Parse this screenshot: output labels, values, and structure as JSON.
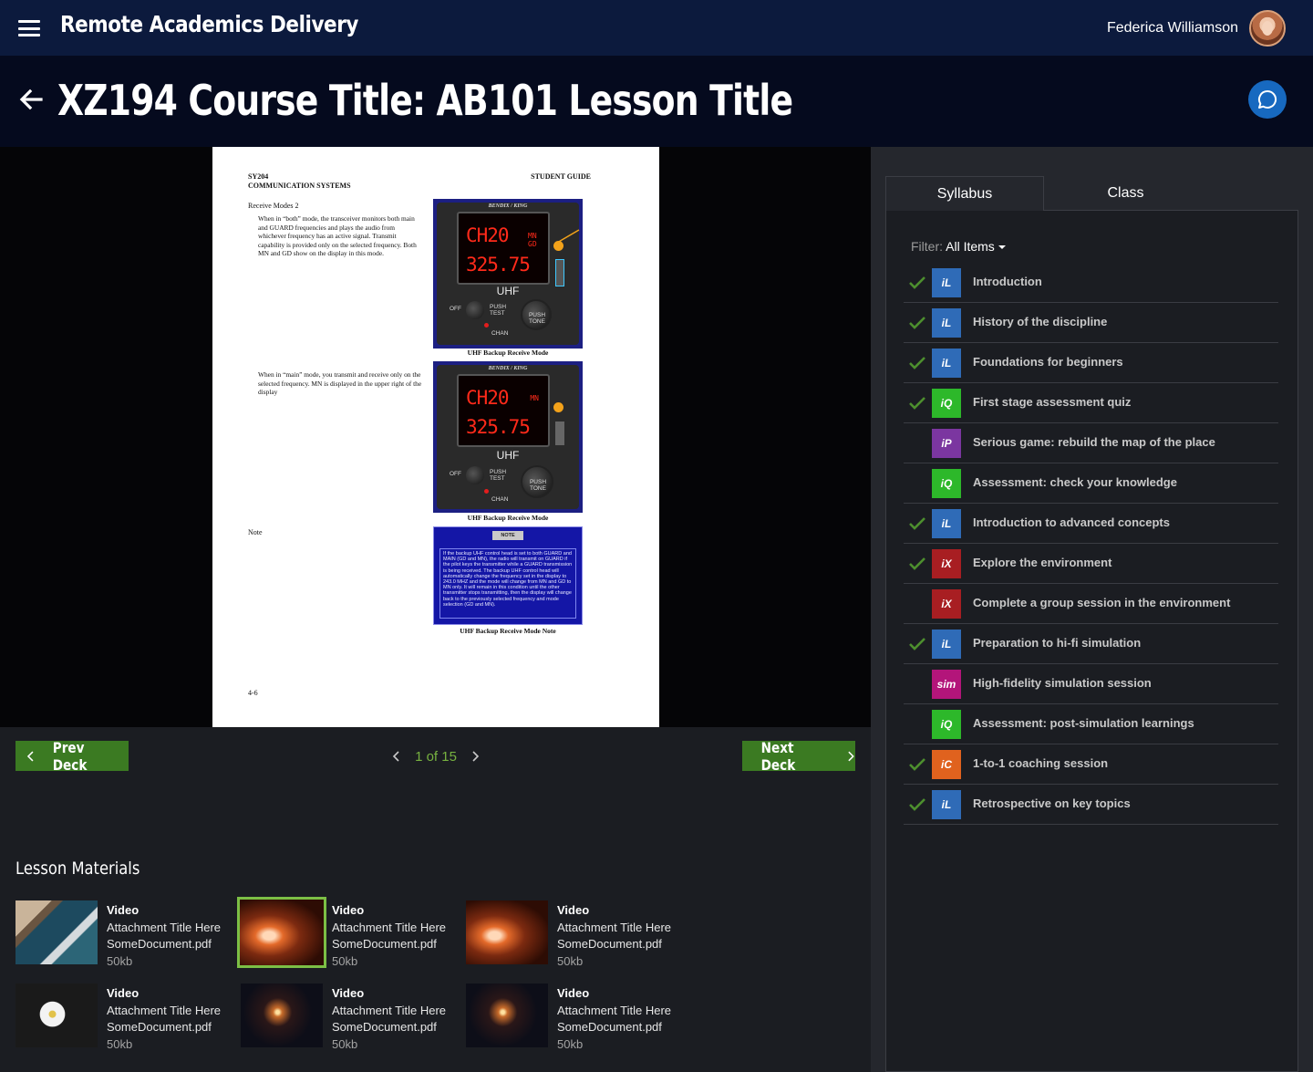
{
  "app": {
    "title": "Remote Academics Delivery",
    "user_name": "Federica Williamson"
  },
  "header": {
    "title": "XZ194 Course Title: AB101 Lesson Title"
  },
  "document": {
    "header_left_1": "SY204",
    "header_left_2": "COMMUNICATION SYSTEMS",
    "header_right": "STUDENT GUIDE",
    "subheading": "Receive Modes 2",
    "para1": "When in “both” mode, the transceiver monitors both main and GUARD frequencies and plays the audio from whichever frequency has an active signal. Transmit capability is provided only on the selected frequency. Both MN and GD show on the display in this mode.",
    "para2": "When in “main” mode, you transmit and receive only on the selected frequency. MN is displayed in the upper right of the display",
    "note_label": "Note",
    "page_number": "4-6",
    "fig1_caption": "UHF Backup Receive Mode",
    "fig2_caption": "UHF Backup Receive Mode",
    "fig3_caption": "UHF Backup Receive Mode Note",
    "radio_brand": "BENDIX / KING",
    "radio_channel": "CH20",
    "radio_freq": "325.75",
    "radio_band": "UHF",
    "radio_off": "OFF",
    "radio_push_test": "PUSH TEST",
    "radio_chan": "CHAN",
    "radio_push_tone": "PUSH TONE",
    "radio_mode": "MODE",
    "radio_mn_gd": "MN GD",
    "radio_mn": "MN",
    "note_badge": "NOTE",
    "note_text": "If the backup UHF control head is set to both GUARD and MAIN (GD and MN), the radio will transmit on GUARD if the pilot keys the transmitter while a GUARD transmission is being received. The backup UHF control head will automatically change the frequency set in the display to 243.0 MHZ and the mode will change from MN and GD to MN only. It will remain in this condition until the other transmitter stops transmitting, then the display will change back to the previously selected frequency and mode selection (GD and MN)."
  },
  "nav": {
    "prev_label": "Prev Deck",
    "next_label": "Next Deck",
    "page_indicator": "1 of 15",
    "current_page": 1,
    "total_pages": 15
  },
  "materials": {
    "title": "Lesson Materials",
    "items": [
      {
        "kind": "Video",
        "title": "Attachment Title Here",
        "file": "SomeDocument.pdf",
        "size": "50kb",
        "thumb": "beach",
        "selected": false
      },
      {
        "kind": "Video",
        "title": "Attachment Title Here",
        "file": "SomeDocument.pdf",
        "size": "50kb",
        "thumb": "canyon",
        "selected": true
      },
      {
        "kind": "Video",
        "title": "Attachment Title Here",
        "file": "SomeDocument.pdf",
        "size": "50kb",
        "thumb": "canyon",
        "selected": false
      },
      {
        "kind": "Video",
        "title": "Attachment Title Here",
        "file": "SomeDocument.pdf",
        "size": "50kb",
        "thumb": "daisy",
        "selected": false
      },
      {
        "kind": "Video",
        "title": "Attachment Title Here",
        "file": "SomeDocument.pdf",
        "size": "50kb",
        "thumb": "sparkler",
        "selected": false
      },
      {
        "kind": "Video",
        "title": "Attachment Title Here",
        "file": "SomeDocument.pdf",
        "size": "50kb",
        "thumb": "sparkler",
        "selected": false
      }
    ]
  },
  "sidebar": {
    "tabs": [
      {
        "label": "Syllabus",
        "active": true
      },
      {
        "label": "Class",
        "active": false
      }
    ],
    "filter_label": "Filter:",
    "filter_value": "All Items",
    "colors": {
      "iL": "#2f6bb7",
      "iQ": "#2db82a",
      "iP": "#7b36a0",
      "iX": "#a81e22",
      "sim": "#b3157a",
      "iC": "#e0621e",
      "check": "#4d8f2e"
    },
    "items": [
      {
        "badge": "iL",
        "label": "Introduction",
        "done": true
      },
      {
        "badge": "iL",
        "label": "History of the discipline",
        "done": true
      },
      {
        "badge": "iL",
        "label": "Foundations for beginners",
        "done": true
      },
      {
        "badge": "iQ",
        "label": "First stage assessment quiz",
        "done": true
      },
      {
        "badge": "iP",
        "label": "Serious game: rebuild the map of the place",
        "done": false
      },
      {
        "badge": "iQ",
        "label": "Assessment: check your knowledge",
        "done": false
      },
      {
        "badge": "iL",
        "label": "Introduction to advanced concepts",
        "done": true
      },
      {
        "badge": "iX",
        "label": "Explore the environment",
        "done": true
      },
      {
        "badge": "iX",
        "label": "Complete a group session in the environment",
        "done": false
      },
      {
        "badge": "iL",
        "label": "Preparation to hi-fi simulation",
        "done": true
      },
      {
        "badge": "sim",
        "label": "High-fidelity simulation session",
        "done": false
      },
      {
        "badge": "iQ",
        "label": "Assessment: post-simulation learnings",
        "done": false
      },
      {
        "badge": "iC",
        "label": "1-to-1 coaching session",
        "done": true
      },
      {
        "badge": "iL",
        "label": "Retrospective on key topics",
        "done": true
      }
    ]
  }
}
